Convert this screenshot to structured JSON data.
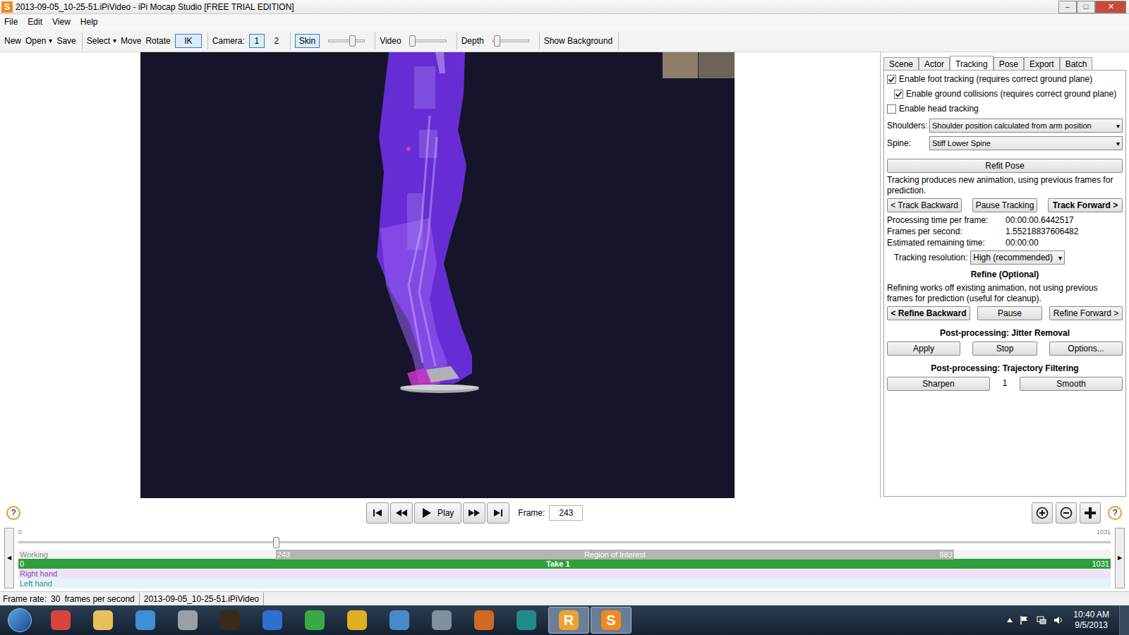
{
  "window": {
    "icon": "S",
    "title": "2013-09-05_10-25-51.iPiVideo - iPi Mocap Studio [FREE TRIAL EDITION]",
    "controls": [
      "–",
      "□",
      "✕"
    ]
  },
  "menu": [
    "File",
    "Edit",
    "View",
    "Help"
  ],
  "toolbar": [
    [
      {
        "kind": "button",
        "label": "New"
      },
      {
        "kind": "dropdown",
        "label": "Open",
        "arrow": "▾"
      },
      {
        "kind": "button",
        "label": "Save"
      }
    ],
    [
      {
        "kind": "dropdown",
        "label": "Select",
        "arrow": "▾"
      },
      {
        "kind": "button",
        "label": "Move"
      },
      {
        "kind": "button",
        "label": "Rotate"
      },
      {
        "kind": "toggle",
        "label": "IK",
        "selected": true
      }
    ],
    [
      {
        "kind": "text",
        "label": "Camera:"
      },
      {
        "kind": "toggle",
        "label": "1",
        "selected": true
      },
      {
        "kind": "toggle",
        "label": "2",
        "selected": false
      }
    ],
    [
      {
        "kind": "toggle",
        "label": "Skin",
        "selected": true
      },
      {
        "kind": "slider",
        "level": 0.66
      }
    ],
    [
      {
        "kind": "text",
        "label": "Video"
      },
      {
        "kind": "slider",
        "level": 0.06
      }
    ],
    [
      {
        "kind": "text",
        "label": "Depth"
      },
      {
        "kind": "slider",
        "level": 0.12
      }
    ],
    [
      {
        "kind": "button",
        "label": "Show Background"
      }
    ]
  ],
  "panel": {
    "tabs": [
      {
        "label": "Scene",
        "selected": false
      },
      {
        "label": "Actor",
        "selected": false
      },
      {
        "label": "Tracking",
        "selected": true
      },
      {
        "label": "Pose",
        "selected": false
      },
      {
        "label": "Export",
        "selected": false
      },
      {
        "label": "Batch",
        "selected": false
      }
    ],
    "checks": [
      {
        "label": "Enable foot tracking (requires correct ground plane)",
        "checked": true,
        "nested": false
      },
      {
        "label": "Enable ground collisions (requires correct ground plane)",
        "checked": true,
        "nested": true
      },
      {
        "label": "Enable head tracking",
        "checked": false,
        "nested": false
      }
    ],
    "selects": [
      {
        "label": "Shoulders:",
        "value": "Shoulder position calculated from arm position",
        "arrow": "▾"
      },
      {
        "label": "Spine:",
        "value": "Stiff Lower Spine",
        "arrow": "▾"
      }
    ],
    "refit": "Refit Pose",
    "tracking_note": "Tracking produces new animation, using previous frames for prediction.",
    "tracking_buttons": [
      {
        "label": "< Track Backward",
        "bold": false
      },
      {
        "label": "Pause Tracking",
        "bold": false
      },
      {
        "label": "Track Forward >",
        "bold": true
      }
    ],
    "stats": [
      {
        "label": "Processing time per frame:",
        "value": "00:00:00.6442517"
      },
      {
        "label": "Frames per second:",
        "value": "1.55218837606482"
      },
      {
        "label": "Estimated remaining time:",
        "value": "00:00:00"
      }
    ],
    "resolution": {
      "label": "Tracking resolution:",
      "value": "High (recommended)",
      "arrow": "▾"
    },
    "refine": {
      "heading": "Refine (Optional)",
      "note": "Refining works off existing animation, not using previous frames for prediction (useful for cleanup).",
      "buttons": [
        {
          "label": "< Refine Backward",
          "bold": true
        },
        {
          "label": "Pause",
          "bold": false
        },
        {
          "label": "Refine Forward >",
          "bold": false
        }
      ]
    },
    "jitter": {
      "heading": "Post-processing: Jitter Removal",
      "buttons": [
        "Apply",
        "Stop",
        "Options..."
      ]
    },
    "trajectory": {
      "heading": "Post-processing: Trajectory Filtering",
      "buttons": [
        "Sharpen",
        "Smooth"
      ],
      "value": "1"
    }
  },
  "playback": {
    "help": "?",
    "buttons": [
      {
        "kind": "first"
      },
      {
        "kind": "rewind"
      },
      {
        "kind": "play",
        "label": "Play"
      },
      {
        "kind": "forward"
      },
      {
        "kind": "last"
      }
    ],
    "frame": {
      "label": "Frame:",
      "value": "243"
    },
    "zoom": [
      {
        "kind": "zoom-in"
      },
      {
        "kind": "zoom-out"
      },
      {
        "kind": "fit"
      }
    ]
  },
  "timeline": {
    "start": "0",
    "end": "1031",
    "level": 0.236,
    "left_arrow": "◀",
    "right_arrow": "▶",
    "working": {
      "label": "Working",
      "start_label": "243",
      "title": "Region of Interest",
      "end_label": "883"
    },
    "take": {
      "start": "0",
      "title": "Take 1",
      "end": "1031"
    },
    "tracks": [
      {
        "label": "Right hand",
        "color": "#f0e2f8",
        "text_color": "#8a4aa6"
      },
      {
        "label": "Left hand",
        "color": "#e5f4f6",
        "text_color": "#3a8a98"
      }
    ]
  },
  "status_bar": {
    "label": "Frame rate:",
    "value": "30",
    "unit": "frames per second",
    "file": "2013-09-05_10-25-51.iPiVideo"
  },
  "taskbar": {
    "apps": [
      {
        "color": "#d9453a",
        "active": false
      },
      {
        "color": "#e8c15a",
        "active": false
      },
      {
        "color": "#3d8fd6",
        "active": false
      },
      {
        "color": "#9aa0a6",
        "active": false
      },
      {
        "color": "#3a2a1a",
        "active": false
      },
      {
        "color": "#2f6fd0",
        "active": false
      },
      {
        "color": "#3aa845",
        "active": false
      },
      {
        "color": "#e0b020",
        "active": false
      },
      {
        "color": "#4a8ac8",
        "active": false
      },
      {
        "color": "#8090a0",
        "active": false
      },
      {
        "color": "#d06a20",
        "active": false
      },
      {
        "color": "#1f8a8a",
        "active": false
      },
      {
        "color": "#f0a030",
        "active": true,
        "glyph": "R"
      },
      {
        "color": "#f08a20",
        "active": true,
        "glyph": "S"
      }
    ],
    "clock": {
      "time": "10:40 AM",
      "date": "9/5/2013"
    }
  }
}
